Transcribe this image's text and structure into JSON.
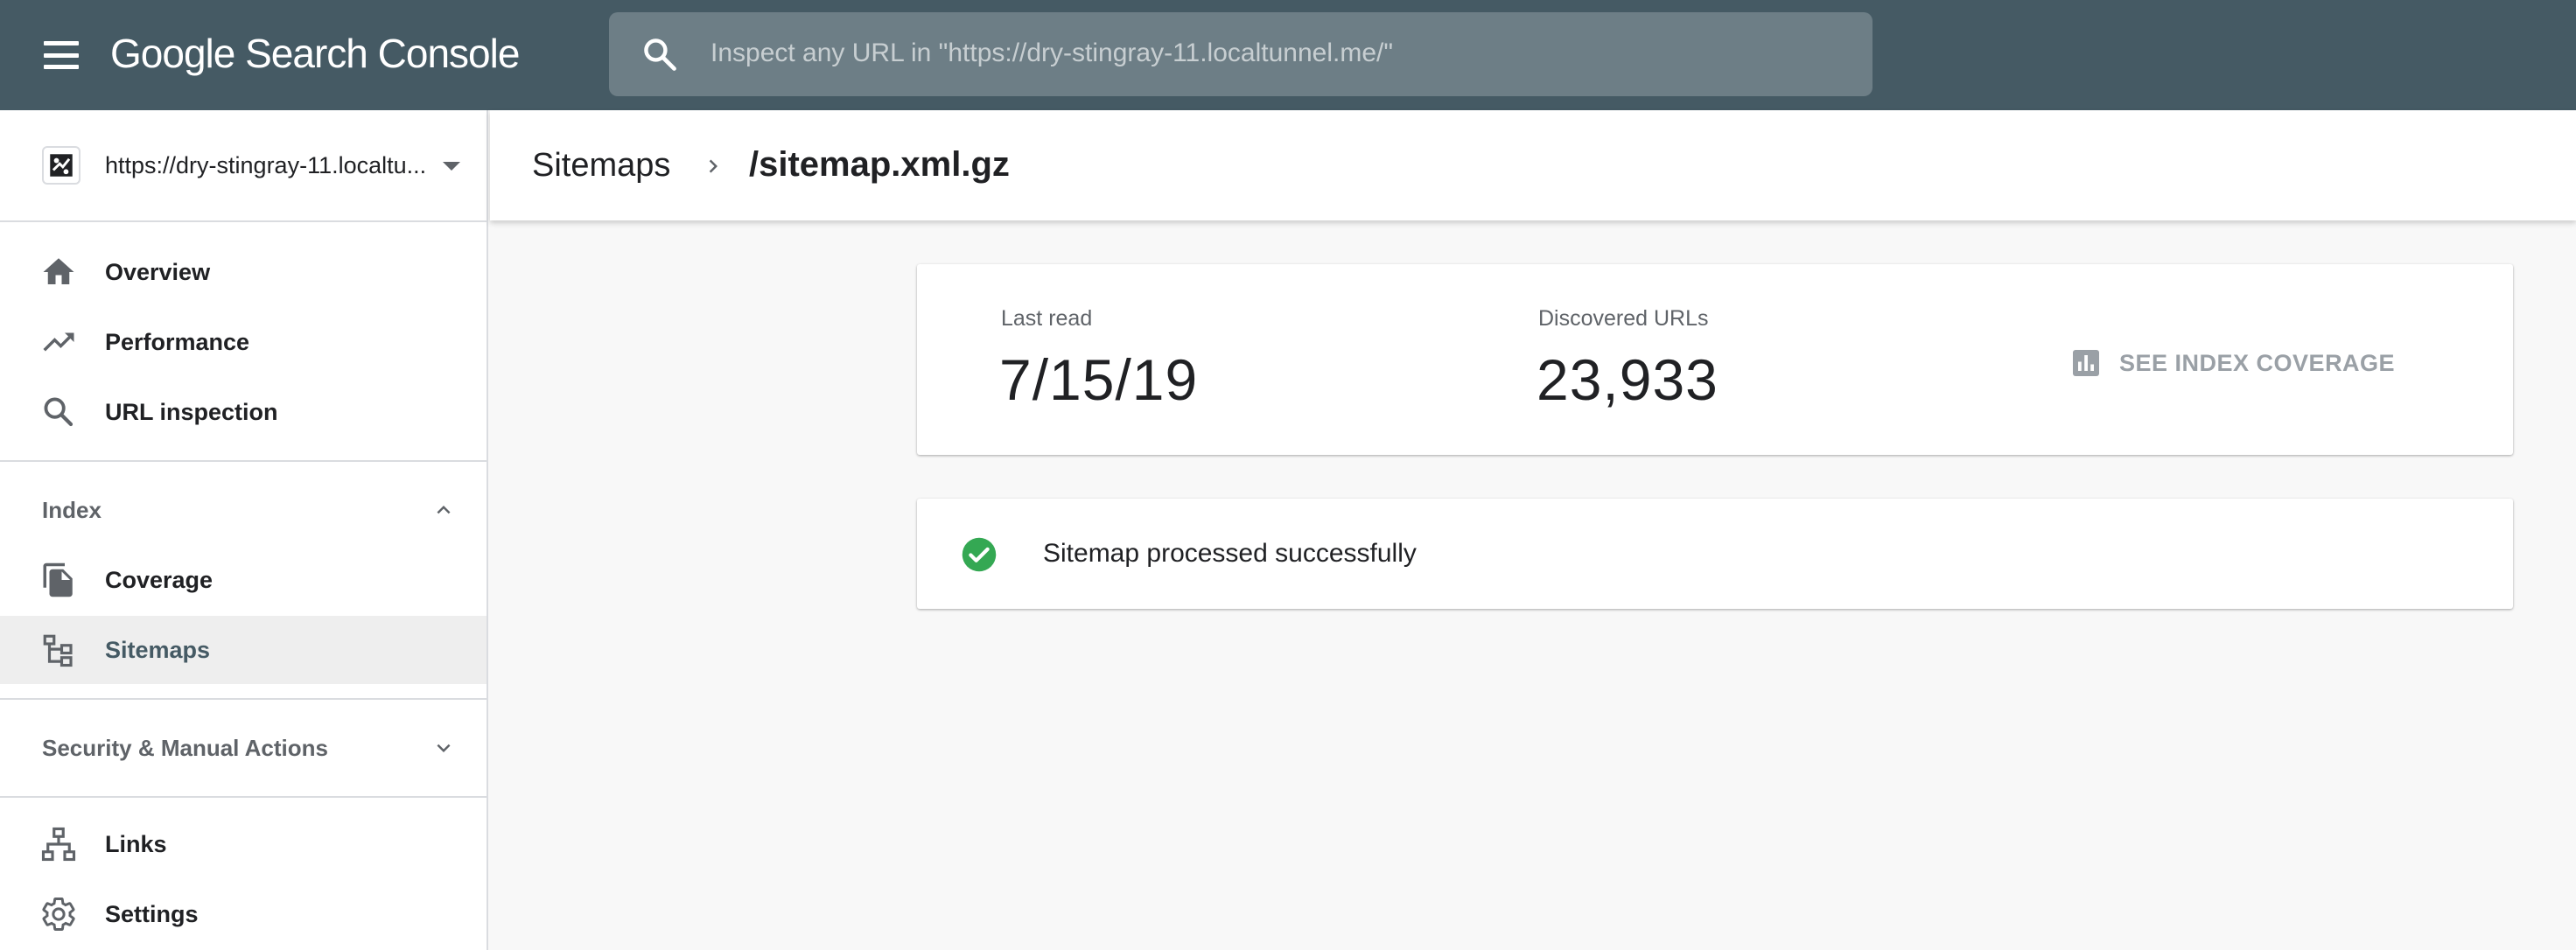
{
  "header": {
    "app_title": "Google Search Console",
    "search_placeholder": "Inspect any URL in \"https://dry-stingray-11.localtunnel.me/\"",
    "menu_icon": "hamburger-menu-icon",
    "search_icon": "search-icon",
    "bar_color": "#455a64"
  },
  "sidebar": {
    "property": {
      "label": "https://dry-stingray-11.localtu...",
      "icon": "property-icon"
    },
    "nav_top": [
      {
        "label": "Overview",
        "icon": "home-icon"
      },
      {
        "label": "Performance",
        "icon": "trending-up-icon"
      },
      {
        "label": "URL inspection",
        "icon": "search-icon"
      }
    ],
    "index_section": {
      "label": "Index",
      "expanded": true,
      "items": [
        {
          "label": "Coverage",
          "icon": "file-copy-icon"
        },
        {
          "label": "Sitemaps",
          "icon": "sitemap-icon",
          "active": true
        }
      ]
    },
    "security_section": {
      "label": "Security & Manual Actions",
      "expanded": false
    },
    "nav_bottom": [
      {
        "label": "Links",
        "icon": "links-icon"
      },
      {
        "label": "Settings",
        "icon": "gear-icon"
      }
    ]
  },
  "page": {
    "breadcrumb_parent": "Sitemaps",
    "breadcrumb_current": "/sitemap.xml.gz"
  },
  "stats": {
    "last_read_label": "Last read",
    "last_read_value": "7/15/19",
    "discovered_label": "Discovered URLs",
    "discovered_value": "23,933",
    "coverage_button": "SEE INDEX COVERAGE"
  },
  "status": {
    "message": "Sitemap processed successfully",
    "icon": "check-circle-icon",
    "color": "#34a853"
  }
}
